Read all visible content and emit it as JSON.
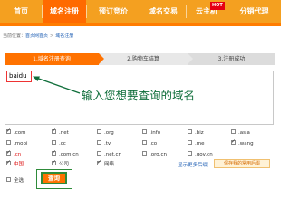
{
  "nav": {
    "items": [
      {
        "label": "首页"
      },
      {
        "label": "域名注册"
      },
      {
        "label": "预订竞价"
      },
      {
        "label": "域名交易"
      },
      {
        "label": "云主机"
      },
      {
        "label": "分销代理"
      }
    ],
    "hot_badge": "HOT",
    "active_index": 1,
    "colors": {
      "bar": "#f4a020",
      "active": "#ff6a00",
      "underline": "#ff7c00"
    }
  },
  "breadcrumb": {
    "prefix": "当前位置：",
    "items": [
      "首页网首页",
      "域名注册"
    ],
    "separator": ">"
  },
  "steps": [
    {
      "label": "1.域名注册查询"
    },
    {
      "label": "2.购物车结算"
    },
    {
      "label": "3.注册成功"
    }
  ],
  "search": {
    "value": "baidu"
  },
  "annotation": {
    "text": "输入您想要查询的域名"
  },
  "tlds": [
    {
      "label": ".com",
      "checked": true
    },
    {
      "label": ".net",
      "checked": true
    },
    {
      "label": ".org",
      "checked": false
    },
    {
      "label": ".info",
      "checked": false
    },
    {
      "label": ".biz",
      "checked": false
    },
    {
      "label": ".asia",
      "checked": false
    },
    {
      "label": ".mobi",
      "checked": false
    },
    {
      "label": ".cc",
      "checked": false
    },
    {
      "label": ".tv",
      "checked": false
    },
    {
      "label": ".co",
      "checked": false
    },
    {
      "label": ".me",
      "checked": false
    },
    {
      "label": ".wang",
      "checked": true
    },
    {
      "label": ".cn",
      "checked": true,
      "highlight": true
    },
    {
      "label": ".com.cn",
      "checked": true
    },
    {
      "label": ".net.cn",
      "checked": false
    },
    {
      "label": ".org.cn",
      "checked": false
    },
    {
      "label": ".gov.cn",
      "checked": false
    },
    {
      "label": "中国",
      "checked": true,
      "highlight": true
    },
    {
      "label": "公司",
      "checked": true
    },
    {
      "label": "网络",
      "checked": true
    }
  ],
  "more_link": "显示更多后缀",
  "save_tip": "保存我的常用后缀",
  "select_all": {
    "label": "全选",
    "checked": false
  },
  "query_button": "查询",
  "colors": {
    "accent": "#ff7200",
    "annotation": "#0f6e3a",
    "highlight_red": "#e33",
    "outline_green": "#2e8b3a"
  }
}
